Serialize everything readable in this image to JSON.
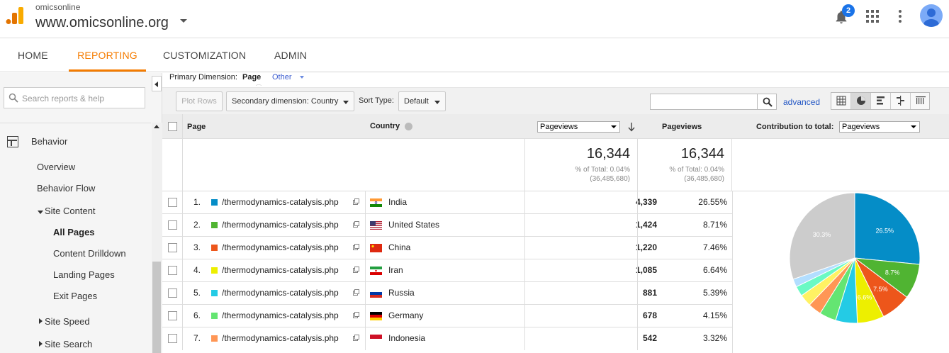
{
  "header": {
    "account_small": "omicsonline",
    "account_property": "www.omicsonline.org",
    "notifications_count": "2",
    "logo_icon": "analytics-logo-icon",
    "brand_colors": {
      "orange": "#f9ab00",
      "dark_orange": "#e37400"
    }
  },
  "nav": {
    "tabs": [
      {
        "label": "HOME"
      },
      {
        "label": "REPORTING",
        "active": true
      },
      {
        "label": "CUSTOMIZATION"
      },
      {
        "label": "ADMIN"
      }
    ],
    "accent": "#f57c00"
  },
  "sidebar": {
    "search_placeholder": "Search reports & help",
    "section": "Behavior",
    "items": {
      "overview": "Overview",
      "behavior_flow": "Behavior Flow",
      "site_content": "Site Content",
      "all_pages": "All Pages",
      "content_drilldown": "Content Drilldown",
      "landing_pages": "Landing Pages",
      "exit_pages": "Exit Pages",
      "site_speed": "Site Speed",
      "site_search": "Site Search"
    }
  },
  "report": {
    "primary_dimension_label": "Primary Dimension:",
    "primary_dimension_value": "Page",
    "other_label": "Other",
    "plot_rows": "Plot Rows",
    "secondary_dimension": "Secondary dimension: Country",
    "sort_type_label": "Sort Type:",
    "sort_type_value": "Default",
    "advanced": "advanced",
    "filter_value": ""
  },
  "table": {
    "headers": {
      "page": "Page",
      "country": "Country",
      "metric_select": "Pageviews",
      "pageviews": "Pageviews",
      "contribution_label": "Contribution to total:",
      "contribution_select": "Pageviews"
    },
    "totals": {
      "pageviews": "16,344",
      "pct_of_total": "% of Total: 0.04%",
      "grand_total": "(36,485,680)",
      "pageviews2": "16,344",
      "pct_of_total2": "% of Total: 0.04%",
      "grand_total2": "(36,485,680)"
    },
    "rows": [
      {
        "num": "1.",
        "page": "/thermodynamics-catalysis.php",
        "country": "India",
        "pageviews": "4,339",
        "pct": "26.55%",
        "color": "#058dc7",
        "flag": "india"
      },
      {
        "num": "2.",
        "page": "/thermodynamics-catalysis.php",
        "country": "United States",
        "pageviews": "1,424",
        "pct": "8.71%",
        "color": "#50b432",
        "flag": "us"
      },
      {
        "num": "3.",
        "page": "/thermodynamics-catalysis.php",
        "country": "China",
        "pageviews": "1,220",
        "pct": "7.46%",
        "color": "#ed561b",
        "flag": "china"
      },
      {
        "num": "4.",
        "page": "/thermodynamics-catalysis.php",
        "country": "Iran",
        "pageviews": "1,085",
        "pct": "6.64%",
        "color": "#edef00",
        "flag": "iran"
      },
      {
        "num": "5.",
        "page": "/thermodynamics-catalysis.php",
        "country": "Russia",
        "pageviews": "881",
        "pct": "5.39%",
        "color": "#24cbe5",
        "flag": "russia"
      },
      {
        "num": "6.",
        "page": "/thermodynamics-catalysis.php",
        "country": "Germany",
        "pageviews": "678",
        "pct": "4.15%",
        "color": "#64e572",
        "flag": "germany"
      },
      {
        "num": "7.",
        "page": "/thermodynamics-catalysis.php",
        "country": "Indonesia",
        "pageviews": "542",
        "pct": "3.32%",
        "color": "#ff9655",
        "flag": "indonesia"
      }
    ]
  },
  "chart_data": {
    "type": "pie",
    "slices": [
      {
        "label": "26.5%",
        "value": 26.55,
        "color": "#058dc7"
      },
      {
        "label": "8.7%",
        "value": 8.71,
        "color": "#50b432"
      },
      {
        "label": "7.5%",
        "value": 7.46,
        "color": "#ed561b"
      },
      {
        "label": "6.6%",
        "value": 6.64,
        "color": "#edef00"
      },
      {
        "label": "",
        "value": 5.39,
        "color": "#24cbe5"
      },
      {
        "label": "",
        "value": 4.15,
        "color": "#64e572"
      },
      {
        "label": "",
        "value": 3.32,
        "color": "#ff9655"
      },
      {
        "label": "",
        "value": 3.0,
        "color": "#fff263"
      },
      {
        "label": "",
        "value": 2.5,
        "color": "#6af9c4"
      },
      {
        "label": "",
        "value": 2.0,
        "color": "#b2deff"
      },
      {
        "label": "30.3%",
        "value": 30.28,
        "color": "#cccccc"
      }
    ]
  }
}
